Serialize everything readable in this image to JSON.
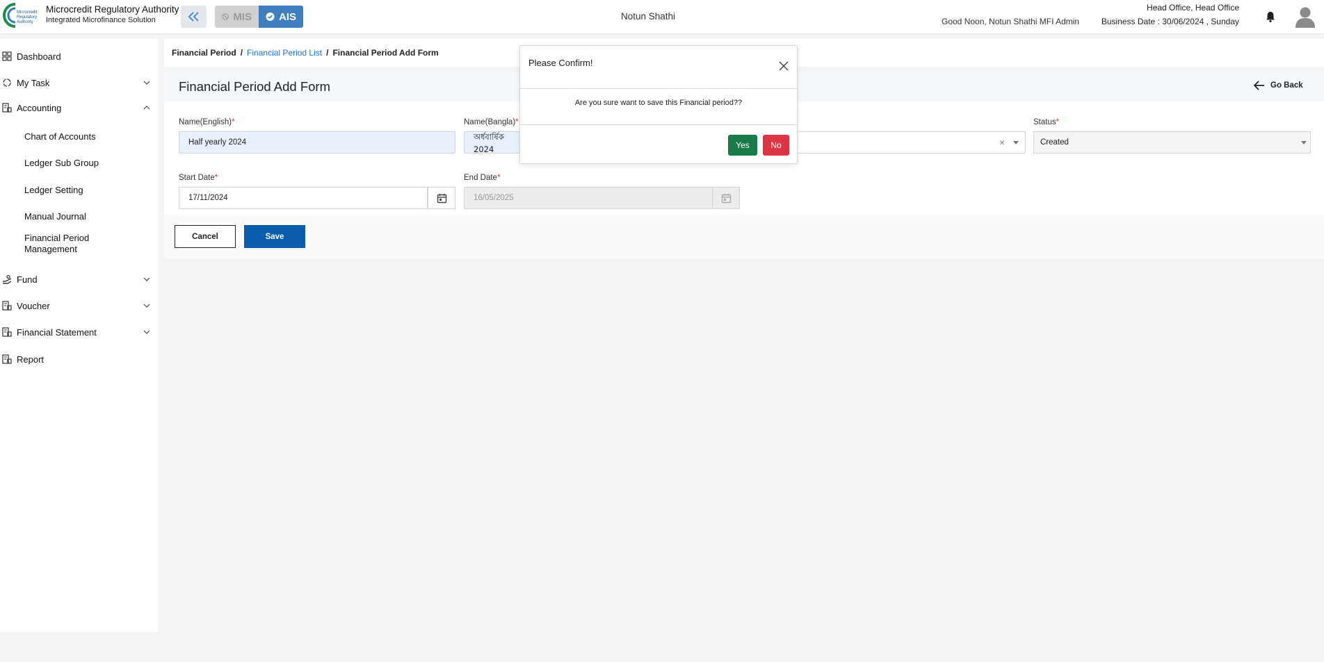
{
  "header": {
    "brand_title": "Microcredit Regulatory Authority",
    "brand_subtitle": "Integrated Microfinance Solution",
    "logo_text": "Microcredit Regulatory Authority",
    "modules": {
      "mis": "MIS",
      "ais": "AIS"
    },
    "center_name": "Notun Shathi",
    "greeting": "Good Noon, Notun Shathi MFI Admin",
    "office": "Head Office, Head Office",
    "business_date": "Business Date : 30/06/2024 , Sunday"
  },
  "sidebar": {
    "items": [
      {
        "label": "Dashboard",
        "icon": "grid-icon"
      },
      {
        "label": "My Task",
        "icon": "task-icon"
      },
      {
        "label": "Accounting",
        "icon": "ledger-icon"
      },
      {
        "label": "Fund",
        "icon": "hand-money-icon"
      },
      {
        "label": "Voucher",
        "icon": "voucher-icon"
      },
      {
        "label": "Financial Statement",
        "icon": "statement-icon"
      },
      {
        "label": "Report",
        "icon": "report-icon"
      }
    ],
    "accounting_sub": [
      "Chart of Accounts",
      "Ledger Sub Group",
      "Ledger Setting",
      "Manual Journal",
      "Financial Period Management"
    ]
  },
  "breadcrumb": {
    "root": "Financial Period",
    "list": "Financial Period List",
    "current": "Financial Period Add Form",
    "sep": "/"
  },
  "form": {
    "title": "Financial Period Add Form",
    "go_back": "Go Back",
    "required_mark": "*",
    "name_en_label": "Name(English)",
    "name_en_value": "Half yearly 2024",
    "name_bn_label": "Name(Bangla)",
    "name_bn_value": "অর্ধবার্ষিক 2024",
    "status_label": "Status",
    "status_value": "Created",
    "start_label": "Start Date",
    "start_value": "17/11/2024",
    "end_label": "End Date",
    "end_value": "16/05/2025",
    "clear_symbol": "×",
    "cancel": "Cancel",
    "save": "Save"
  },
  "modal": {
    "title": "Please Confirm!",
    "message": "Are you sure want to save this Financial period??",
    "yes": "Yes",
    "no": "No"
  },
  "colors": {
    "primary": "#0b5cad",
    "ais_active": "#3f7fbf",
    "yes": "#1b7a4a",
    "no": "#dc3545",
    "link": "#1a73e8"
  }
}
